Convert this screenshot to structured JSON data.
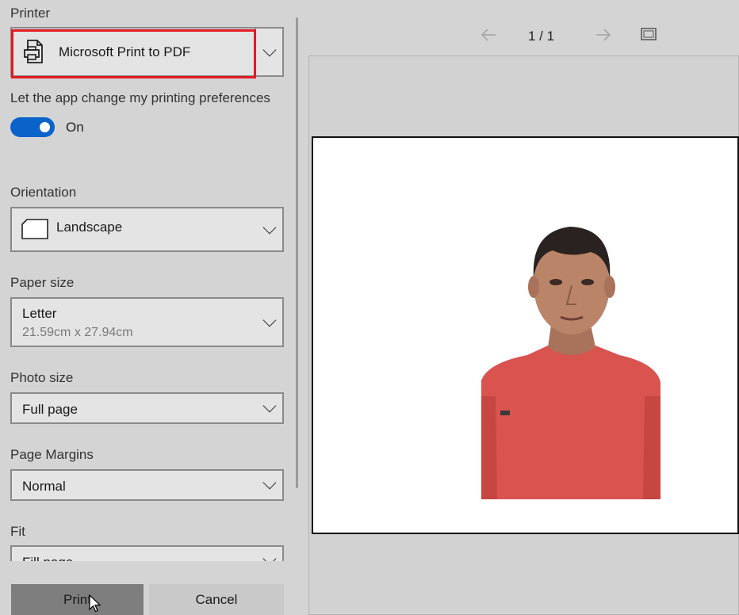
{
  "printer": {
    "label": "Printer",
    "selected": "Microsoft Print to PDF",
    "icon": "printer-icon"
  },
  "preferences": {
    "label": "Let the app change my printing preferences",
    "toggle_state": "On",
    "toggle_on": true
  },
  "orientation": {
    "label": "Orientation",
    "selected": "Landscape",
    "icon": "landscape-page-icon"
  },
  "paper_size": {
    "label": "Paper size",
    "selected": "Letter",
    "dimensions": "21.59cm x 27.94cm"
  },
  "photo_size": {
    "label": "Photo size",
    "selected": "Full page"
  },
  "page_margins": {
    "label": "Page Margins",
    "selected": "Normal"
  },
  "fit": {
    "label": "Fit",
    "selected": "Fill page"
  },
  "buttons": {
    "print": "Print",
    "cancel": "Cancel"
  },
  "preview": {
    "page_indicator": "1 / 1",
    "current_page": 1,
    "total_pages": 1
  },
  "colors": {
    "accent": "#0a63c9",
    "highlight_border": "#e01b24",
    "shirt": "#d9534f"
  }
}
